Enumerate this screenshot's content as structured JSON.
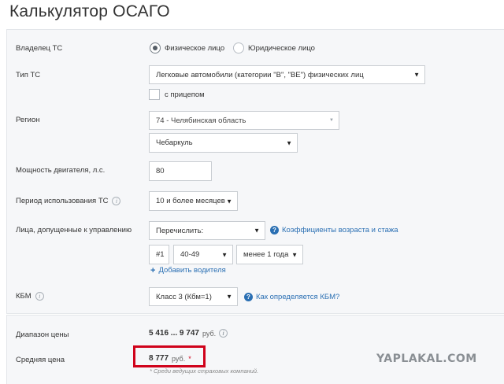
{
  "page": {
    "title": "Калькулятор ОСАГО"
  },
  "owner": {
    "label": "Владелец ТС",
    "options": [
      {
        "label": "Физическое лицо",
        "selected": true
      },
      {
        "label": "Юридическое лицо",
        "selected": false
      }
    ]
  },
  "vehicle_type": {
    "label": "Тип ТС",
    "value": "Легковые автомобили (категории \"B\", \"BE\") физических лиц",
    "trailer_label": "с прицепом"
  },
  "region": {
    "label": "Регион",
    "region_value": "74 - Челябинская область",
    "city_value": "Чебаркуль"
  },
  "engine_power": {
    "label": "Мощность двигателя, л.с.",
    "value": "80"
  },
  "usage_period": {
    "label": "Период использования ТС",
    "value": "10 и более месяцев"
  },
  "drivers": {
    "label": "Лица, допущенные к управлению",
    "mode_value": "Перечислить:",
    "help_link": "Коэффициенты возраста и стажа",
    "driver_number": "#1",
    "age_value": "40-49",
    "experience_value": "менее 1 года",
    "add_link": "Добавить водителя"
  },
  "kbm": {
    "label": "КБМ",
    "value": "Класс 3 (Кбм=1)",
    "help_link": "Как определяется КБМ?"
  },
  "results": {
    "range_label": "Диапазон цены",
    "range_value": "5 416 ... 9 747",
    "currency": "руб.",
    "avg_label": "Средняя цена",
    "avg_value": "8 777",
    "avg_star": "*",
    "footnote": "* Среди ведущих страховых компаний."
  },
  "watermark": "YAPLAKAL.COM",
  "colors": {
    "link": "#2a6fb3",
    "highlight": "#d0021b",
    "panel": "#f6f7f9"
  }
}
